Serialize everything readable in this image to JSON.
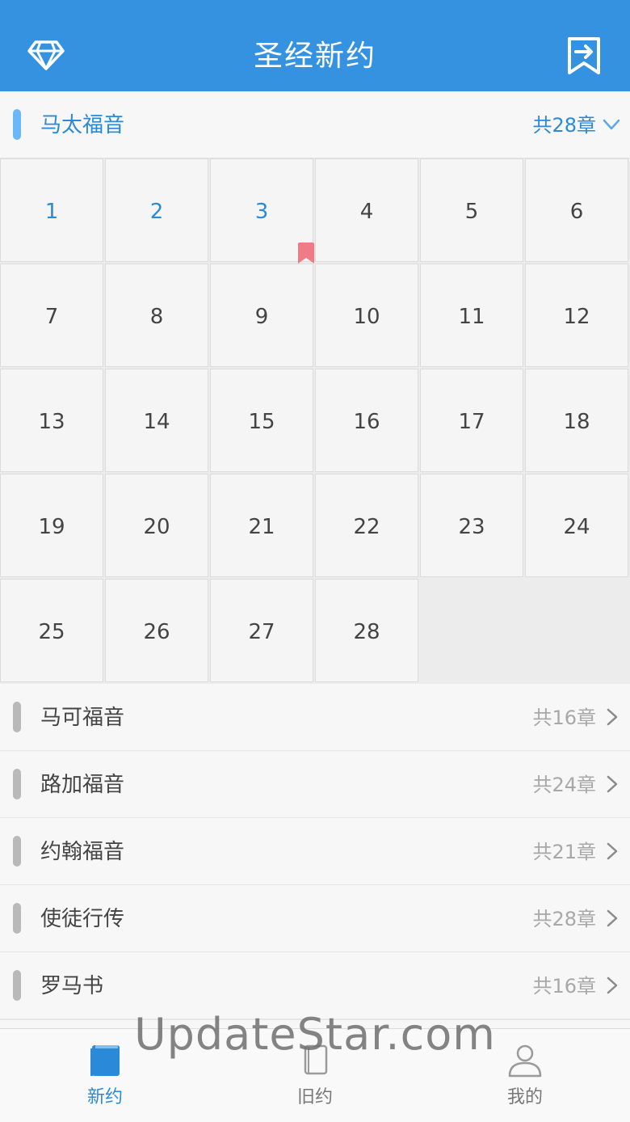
{
  "header": {
    "title": "圣经新约",
    "left_icon": "diamond-icon",
    "right_icon": "bookmark-jump-icon"
  },
  "current_book": {
    "name": "马太福音",
    "count": "共28章",
    "chapters": [
      "1",
      "2",
      "3",
      "4",
      "5",
      "6",
      "7",
      "8",
      "9",
      "10",
      "11",
      "12",
      "13",
      "14",
      "15",
      "16",
      "17",
      "18",
      "19",
      "20",
      "21",
      "22",
      "23",
      "24",
      "25",
      "26",
      "27",
      "28"
    ],
    "read_chapters": [
      "1",
      "2",
      "3"
    ],
    "bookmarked_chapter": "3"
  },
  "books": [
    {
      "name": "马可福音",
      "count": "共16章"
    },
    {
      "name": "路加福音",
      "count": "共24章"
    },
    {
      "name": "约翰福音",
      "count": "共21章"
    },
    {
      "name": "使徒行传",
      "count": "共28章"
    },
    {
      "name": "罗马书",
      "count": "共16章"
    }
  ],
  "tabs": [
    {
      "label": "新约",
      "icon": "book-icon",
      "active": true
    },
    {
      "label": "旧约",
      "icon": "book-outline-icon",
      "active": false
    },
    {
      "label": "我的",
      "icon": "user-icon",
      "active": false
    }
  ],
  "watermark": "UpdateStar.com",
  "colors": {
    "primary": "#3592e0",
    "accent_bar": "#6ab8f7",
    "bookmark": "#f07a86"
  }
}
